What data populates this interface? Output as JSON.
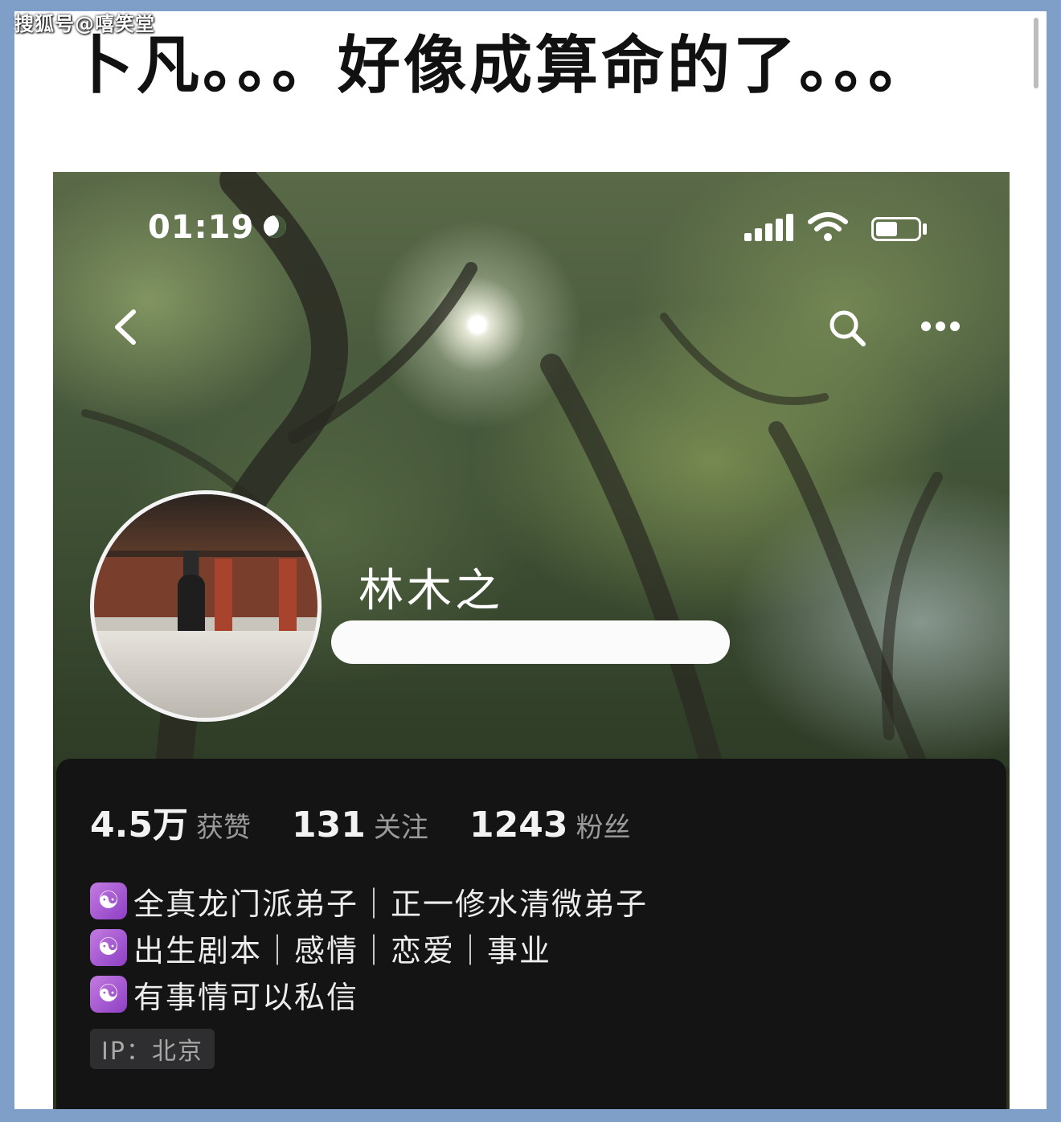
{
  "watermark": "搜狐号@嘻笑堂",
  "headline": "卜凡。。。好像成算命的了。。。",
  "profile": {
    "status_time": "01:19",
    "icons": {
      "moon": "moon-icon",
      "signal": "signal-icon",
      "wifi": "wifi-icon",
      "battery": "battery-icon",
      "back": "back-icon",
      "search": "search-icon",
      "more": "more-icon",
      "bio": "yin-yang-icon"
    },
    "username": "林木之",
    "stats": [
      {
        "value": "4.5万",
        "label": "获赞"
      },
      {
        "value": "131",
        "label": "关注"
      },
      {
        "value": "1243",
        "label": "粉丝"
      }
    ],
    "bio_icon_glyph": "☯",
    "bio": [
      "全真龙门派弟子｜正一修水清微弟子",
      "出生剧本｜感情｜恋爱｜事业",
      "有事情可以私信"
    ],
    "ip_label": "IP：北京"
  },
  "colors": {
    "frame": "#7f9fc8",
    "panel": "#141415",
    "bio_icon": "#a45ad0"
  }
}
